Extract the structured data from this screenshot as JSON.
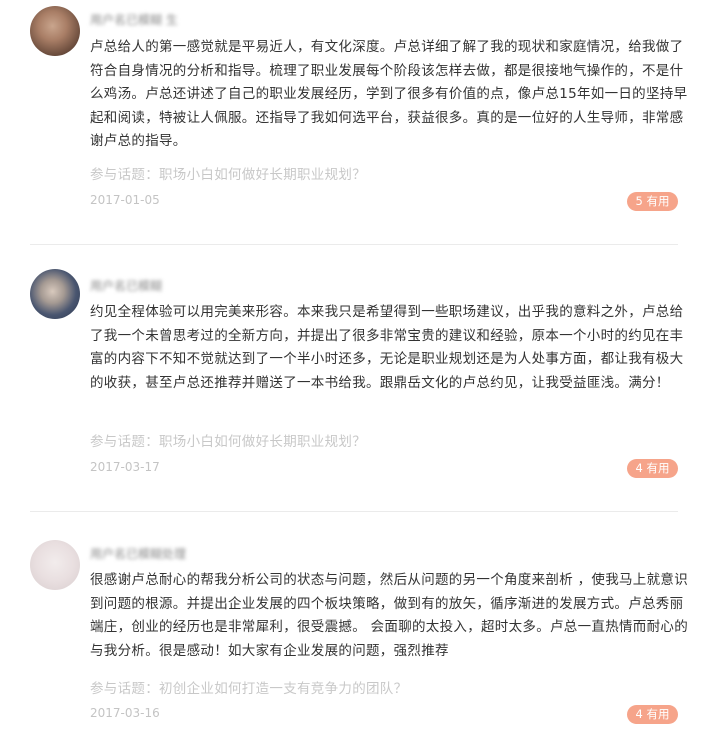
{
  "reviews": [
    {
      "username": "用户名已模糊 生",
      "body": "卢总给人的第一感觉就是平易近人，有文化深度。卢总详细了解了我的现状和家庭情况，给我做了符合自身情况的分析和指导。梳理了职业发展每个阶段该怎样去做，都是很接地气操作的，不是什么鸡汤。卢总还讲述了自己的职业发展经历，学到了很多有价值的点，像卢总15年如一日的坚持早起和阅读，特被让人佩服。还指导了我如何选平台，获益很多。真的是一位好的人生导师，非常感谢卢总的指导。",
      "topic_prefix": "参与话题：",
      "topic": "职场小白如何做好长期职业规划？",
      "date": "2017-01-05",
      "useful": "5 有用"
    },
    {
      "username": "用户名已模糊",
      "body": "约见全程体验可以用完美来形容。本来我只是希望得到一些职场建议，出乎我的意料之外，卢总给了我一个未曾思考过的全新方向，并提出了很多非常宝贵的建议和经验，原本一个小时的约见在丰富的内容下不知不觉就达到了一个半小时还多，无论是职业规划还是为人处事方面，都让我有极大的收获，甚至卢总还推荐并赠送了一本书给我。跟鼎岳文化的卢总约见，让我受益匪浅。满分！",
      "topic_prefix": "参与话题：",
      "topic": "职场小白如何做好长期职业规划？",
      "date": "2017-03-17",
      "useful": "4 有用"
    },
    {
      "username": "用户名已模糊处理",
      "body": "很感谢卢总耐心的帮我分析公司的状态与问题，然后从问题的另一个角度来剖析 ，使我马上就意识到问题的根源。并提出企业发展的四个板块策略，做到有的放矢，循序渐进的发展方式。卢总秀丽端庄，创业的经历也是非常犀利，很受震撼。 会面聊的太投入，超时太多。卢总一直热情而耐心的与我分析。很是感动！如大家有企业发展的问题，强烈推荐",
      "topic_prefix": "参与话题：",
      "topic": "初创企业如何打造一支有竞争力的团队？",
      "date": "2017-03-16",
      "useful": "4 有用"
    }
  ],
  "colors": {
    "body_text": "#333333",
    "meta_text": "#c8c8c8",
    "useful_badge_bg": "#f6a48a",
    "useful_badge_text": "#ffffff",
    "divider": "#ebebeb"
  },
  "icons": {
    "avatar_1": "avatar-image",
    "avatar_2": "avatar-image",
    "avatar_3": "avatar-image"
  }
}
